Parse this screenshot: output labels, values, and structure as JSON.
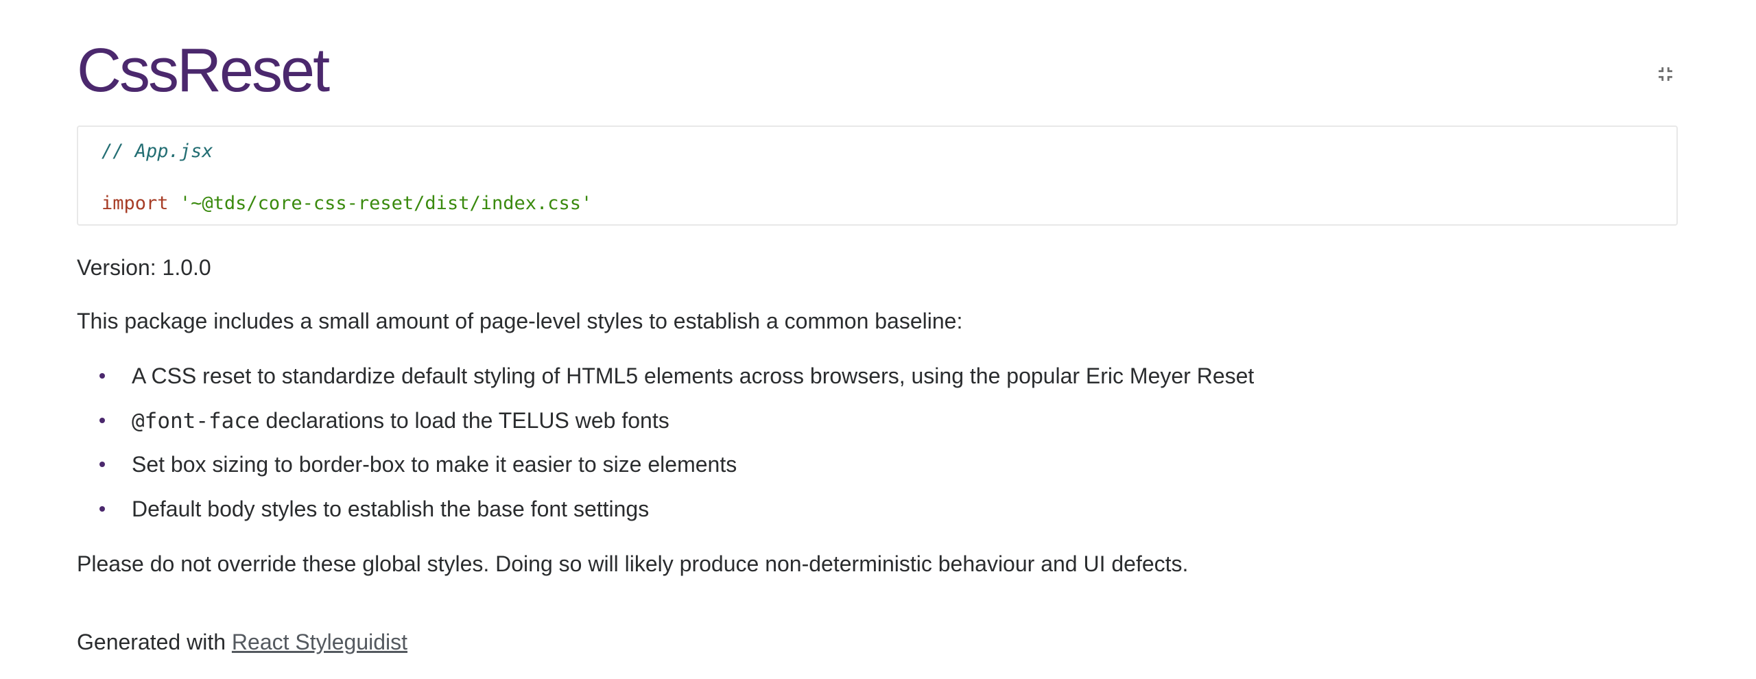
{
  "header": {
    "title": "CssReset",
    "isolate_icon": "collapse-icon"
  },
  "code": {
    "comment": "// App.jsx",
    "keyword": "import",
    "string": "'~@tds/core-css-reset/dist/index.css'"
  },
  "version": "Version: 1.0.0",
  "intro": "This package includes a small amount of page-level styles to establish a common baseline:",
  "bullets": {
    "item1": "A CSS reset to standardize default styling of HTML5 elements across browsers, using the popular Eric Meyer Reset",
    "item2_code": "@font-face",
    "item2_text": " declarations to load the TELUS web fonts",
    "item3": "Set box sizing to border-box to make it easier to size elements",
    "item4": "Default body styles to establish the base font settings"
  },
  "warning": "Please do not override these global styles. Doing so will likely produce non-deterministic behaviour and UI defects.",
  "footer": {
    "prefix": "Generated with ",
    "link_label": "React Styleguidist"
  },
  "colors": {
    "title": "#4b286d",
    "keyword": "#a73d26",
    "string": "#3a8a0e",
    "comment": "#236e73",
    "bullet": "#4b286d"
  }
}
